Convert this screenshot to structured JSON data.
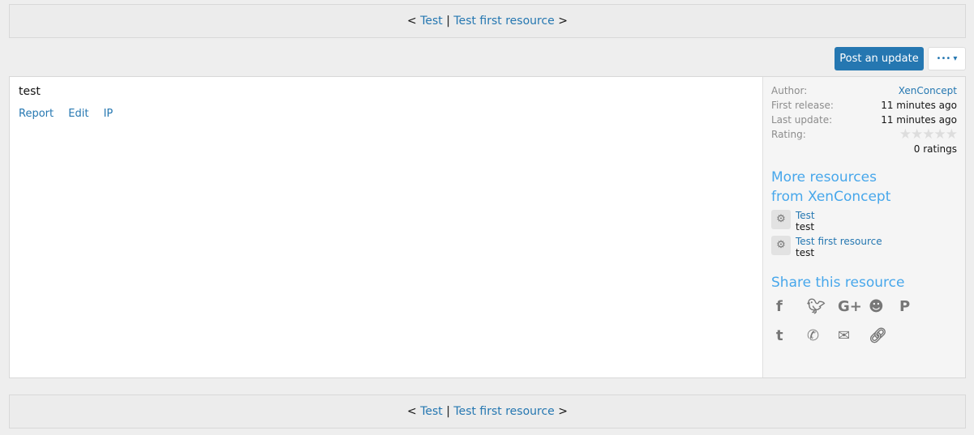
{
  "nav": {
    "prev": "<",
    "link1": "Test",
    "sep": "|",
    "link2": "Test first resource",
    "next": ">"
  },
  "actions": {
    "post_update": "Post an update",
    "more": "••• ▾"
  },
  "post": {
    "text": "test",
    "links": [
      "Report",
      "Edit",
      "IP"
    ]
  },
  "info": {
    "author_label": "Author:",
    "author": "XenConcept",
    "first_label": "First release:",
    "first": "11 minutes ago",
    "last_label": "Last update:",
    "last": "11 minutes ago",
    "rating_label": "Rating:",
    "rating_value": 0,
    "stars": "★★★★★",
    "ratings": "0 ratings"
  },
  "more": {
    "title": "More resources from XenConcept",
    "items": [
      {
        "title": "Test",
        "desc": "test"
      },
      {
        "title": "Test first resource",
        "desc": "test"
      }
    ]
  },
  "share": {
    "title": "Share this resource",
    "icons": [
      "facebook",
      "twitter",
      "google-plus",
      "reddit",
      "pinterest",
      "tumblr",
      "whatsapp",
      "email",
      "link"
    ]
  }
}
